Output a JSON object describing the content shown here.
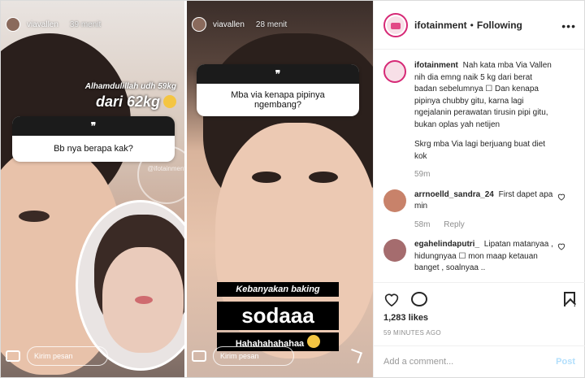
{
  "header": {
    "username": "ifotainment",
    "separator": "•",
    "follow_state": "Following",
    "more": "•••"
  },
  "story_left": {
    "user": "viavallen",
    "time": "39 menit",
    "caption_small": "Alhamdulillah udh 59kg",
    "caption_big": "dari 62kg",
    "question_mark": "❞",
    "question": "Bb nya berapa kak?",
    "watermark": "@ifotainment",
    "message_placeholder": "Kirim pesan"
  },
  "story_right": {
    "user": "viavallen",
    "time": "28 menit",
    "question_mark": "❞",
    "question": "Mba via kenapa pipinya ngembang?",
    "text1": "Kebanyakan baking",
    "text2": "sodaaa",
    "text3": "Hahahahahahaa",
    "message_placeholder": "Kirim pesan"
  },
  "comments": [
    {
      "user": "ifotainment",
      "text": "Nah kata mba Via Vallen nih dia emng naik 5 kg dari berat badan sebelumnya ☐ Dan kenapa pipinya chubby gitu, karna lagi ngejalanin perawatan tirusin pipi gitu, bukan oplas yah netijen",
      "text2": "Skrg mba Via lagi berjuang buat diet kok",
      "time": "59m"
    },
    {
      "user": "arrnoelld_sandra_24",
      "text": "First dapet apa min",
      "time": "58m",
      "reply": "Reply"
    },
    {
      "user": "egahelindaputri_",
      "text": "Lipatan matanyaa , hidungnyaa ☐ mon maap ketauan banget , soalnyaa .."
    }
  ],
  "likes": "1,283 likes",
  "time_ago": "59 MINUTES AGO",
  "add_comment": {
    "placeholder": "Add a comment...",
    "post": "Post"
  },
  "colors": {
    "accent": "#d62976",
    "post_disabled": "#b2dffc",
    "muted": "#8e8e8e"
  }
}
